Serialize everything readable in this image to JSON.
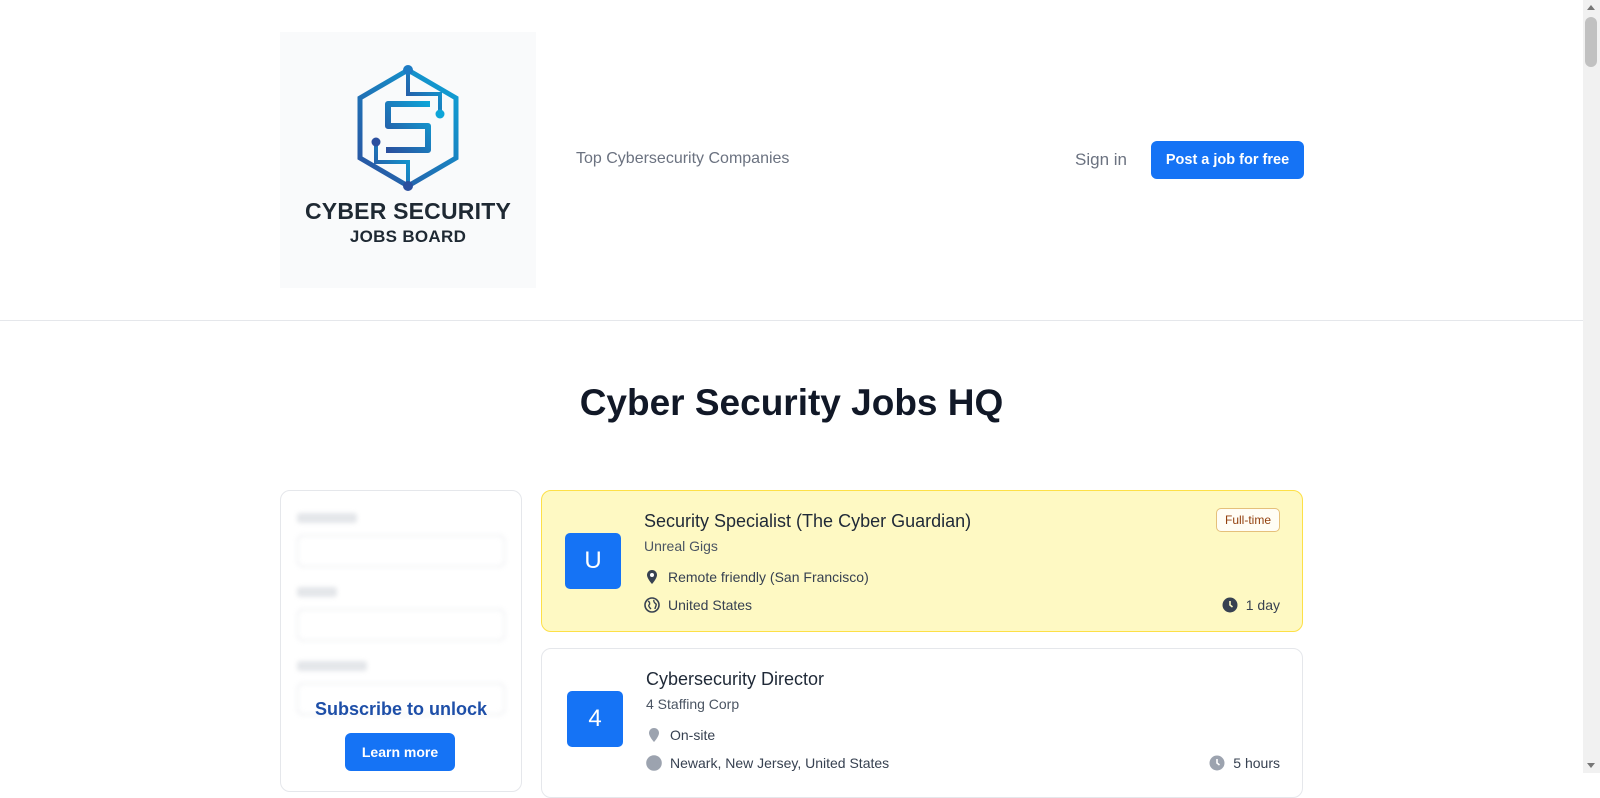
{
  "header": {
    "logo_line1": "CYBER SECURITY",
    "logo_line2": "JOBS BOARD",
    "nav_link": "Top Cybersecurity Companies",
    "sign_in": "Sign in",
    "post_job": "Post a job for free"
  },
  "main": {
    "title": "Cyber Security Jobs HQ"
  },
  "sidebar": {
    "unlock_title": "Subscribe to unlock",
    "learn_more": "Learn more"
  },
  "jobs": [
    {
      "avatar": "U",
      "title": "Security Specialist (The Cyber Guardian)",
      "company": "Unreal Gigs",
      "badge": "Full-time",
      "location": "Remote friendly (San Francisco)",
      "region": "United States",
      "posted": "1 day"
    },
    {
      "avatar": "4",
      "title": "Cybersecurity Director",
      "company": "4 Staffing Corp",
      "location": "On-site",
      "region": "Newark, New Jersey, United States",
      "posted": "5 hours"
    }
  ],
  "colors": {
    "primary": "#1573f5",
    "featured_bg": "#fef9c3",
    "featured_border": "#fde047"
  },
  "icons": [
    "logo-hex-icon",
    "location-pin-icon",
    "globe-icon",
    "clock-icon"
  ]
}
